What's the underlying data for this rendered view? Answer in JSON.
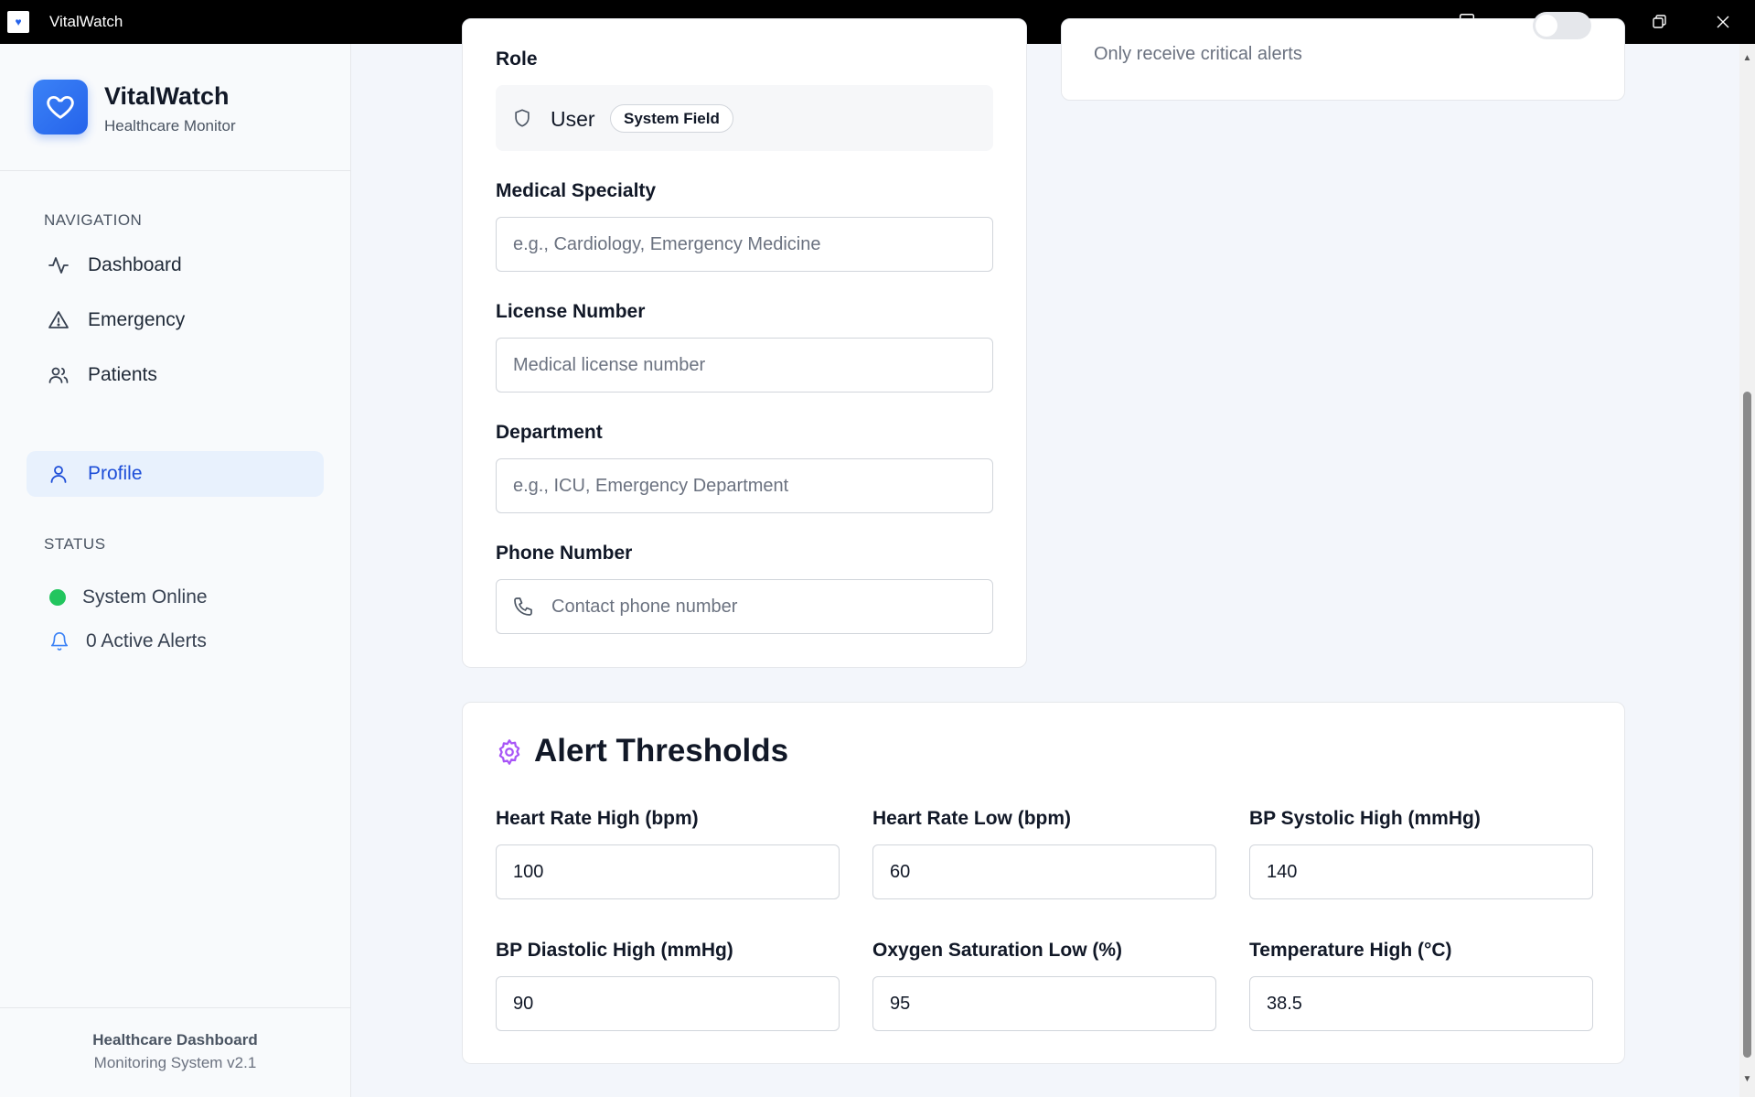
{
  "window": {
    "title": "VitalWatch"
  },
  "brand": {
    "name": "VitalWatch",
    "subtitle": "Healthcare Monitor"
  },
  "nav": {
    "section_label": "NAVIGATION",
    "items": [
      {
        "label": "Dashboard",
        "icon": "activity-icon"
      },
      {
        "label": "Emergency",
        "icon": "warning-icon"
      },
      {
        "label": "Patients",
        "icon": "users-icon"
      },
      {
        "label": "Profile",
        "icon": "user-icon",
        "active": true
      }
    ]
  },
  "status": {
    "section_label": "STATUS",
    "system": "System Online",
    "alerts": "0 Active Alerts",
    "online_color": "#22c55e"
  },
  "footer": {
    "line1": "Healthcare Dashboard",
    "line2": "Monitoring System v2.1"
  },
  "profile_form": {
    "role_label": "Role",
    "role_value": "User",
    "role_badge": "System Field",
    "specialty_label": "Medical Specialty",
    "specialty_placeholder": "e.g., Cardiology, Emergency Medicine",
    "license_label": "License Number",
    "license_placeholder": "Medical license number",
    "department_label": "Department",
    "department_placeholder": "e.g., ICU, Emergency Department",
    "phone_label": "Phone Number",
    "phone_placeholder": "Contact phone number"
  },
  "notifications": {
    "critical_only_desc": "Only receive critical alerts",
    "critical_only_enabled": false
  },
  "thresholds": {
    "title": "Alert Thresholds",
    "accent": "#a855f7",
    "fields": [
      {
        "label": "Heart Rate High (bpm)",
        "value": "100"
      },
      {
        "label": "Heart Rate Low (bpm)",
        "value": "60"
      },
      {
        "label": "BP Systolic High (mmHg)",
        "value": "140"
      },
      {
        "label": "BP Diastolic High (mmHg)",
        "value": "90"
      },
      {
        "label": "Oxygen Saturation Low (%)",
        "value": "95"
      },
      {
        "label": "Temperature High (°C)",
        "value": "38.5"
      }
    ]
  }
}
